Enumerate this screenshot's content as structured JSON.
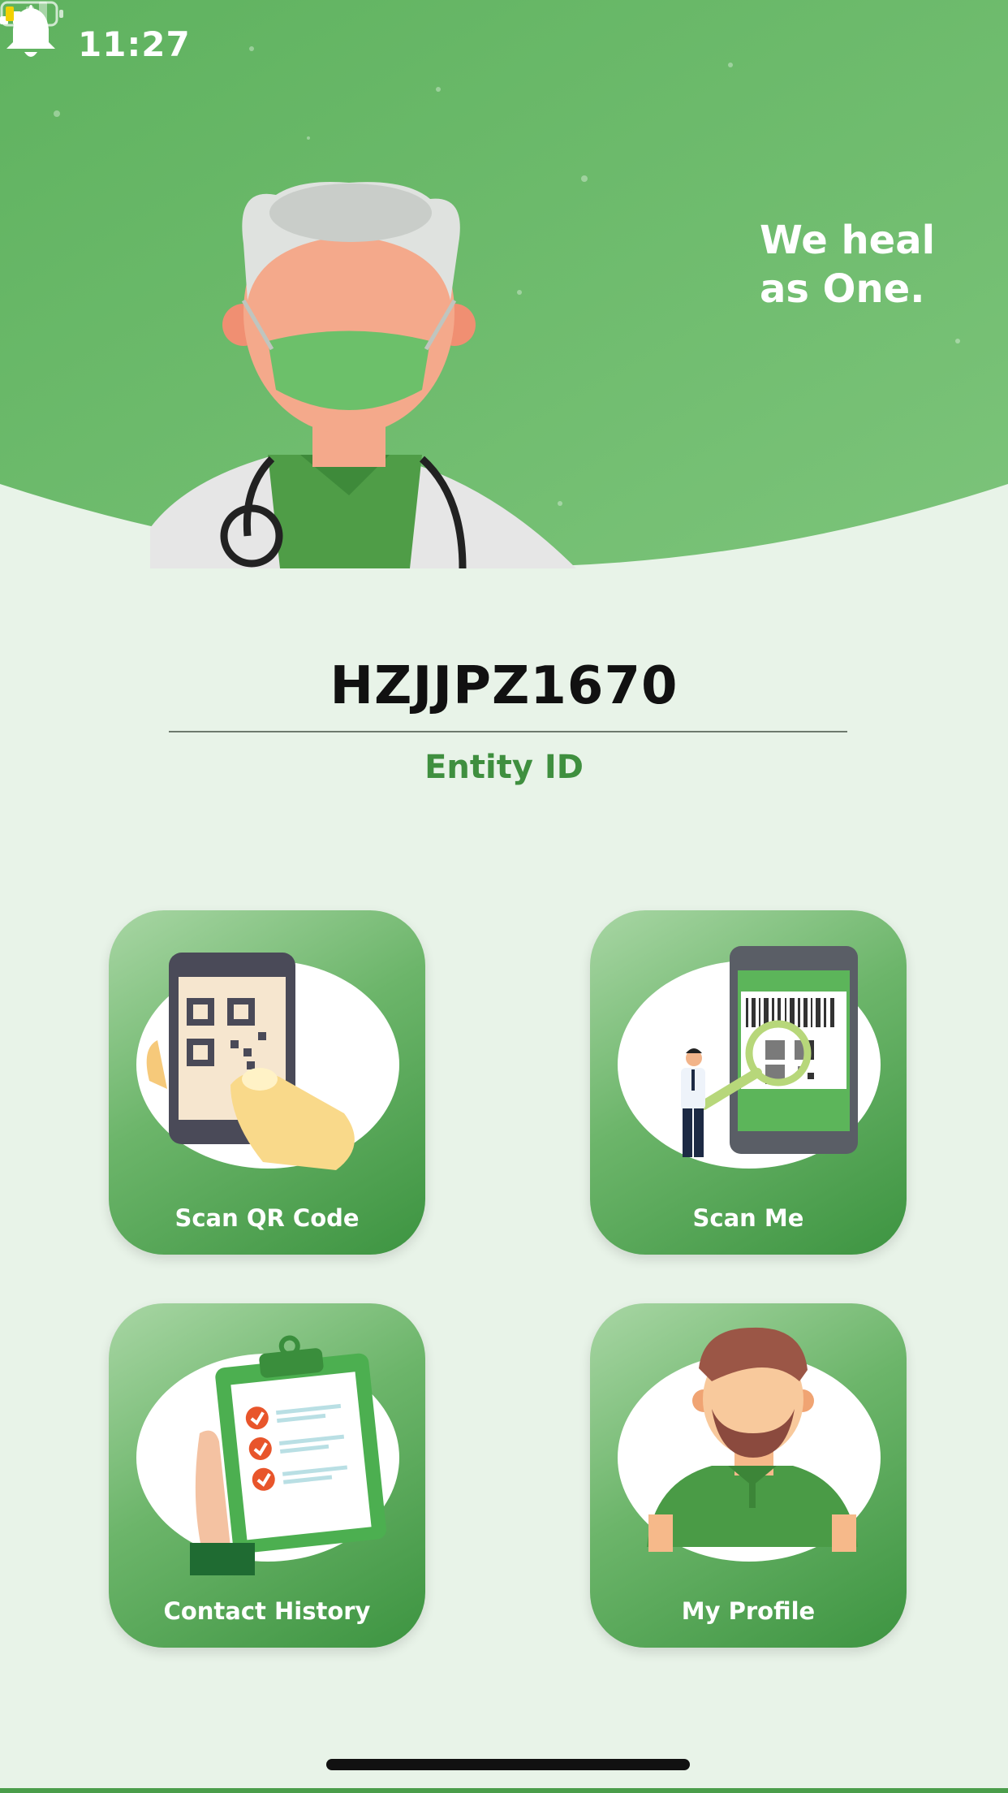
{
  "status_bar": {
    "time": "11:27"
  },
  "header": {
    "tagline_line1": "We heal",
    "tagline_line2": "as One."
  },
  "entity": {
    "id": "HZJJPZ1670",
    "label": "Entity ID"
  },
  "tiles": [
    {
      "label": "Scan QR Code",
      "icon": "scan-qr-illustration"
    },
    {
      "label": "Scan Me",
      "icon": "scan-me-illustration"
    },
    {
      "label": "Contact History",
      "icon": "clipboard-checklist-illustration"
    },
    {
      "label": "My Profile",
      "icon": "user-avatar-illustration"
    }
  ],
  "colors": {
    "primary": "#4caf50",
    "background": "#e8f3e8",
    "accent_text": "#3f8f3f"
  }
}
